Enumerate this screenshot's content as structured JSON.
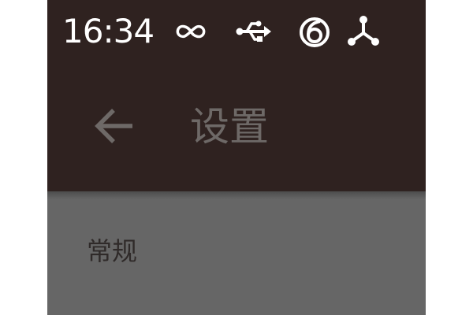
{
  "status_bar": {
    "time": "16:34",
    "icons": [
      "infinity-icon",
      "usb-icon",
      "sync-circle-icon",
      "share-nodes-icon"
    ]
  },
  "toolbar": {
    "back_icon": "arrow-back-icon",
    "title": "设置"
  },
  "settings": {
    "header": "常规"
  },
  "colors": {
    "appbar_bg": "#2f2220",
    "content_bg": "#666666",
    "title_text": "#6e6967",
    "header_text": "#2f2a29",
    "status_text": "#ffffff"
  }
}
